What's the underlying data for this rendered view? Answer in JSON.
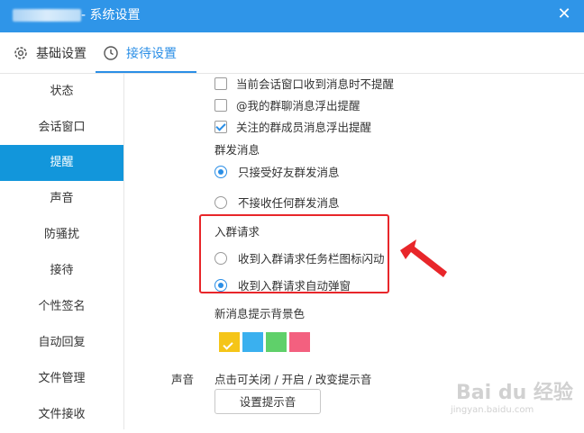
{
  "window": {
    "title": "- 系统设置",
    "close_glyph": "✕"
  },
  "tabs": [
    {
      "label": "基础设置",
      "icon": "gear-icon"
    },
    {
      "label": "接待设置",
      "icon": "clock-icon",
      "active": true
    }
  ],
  "sidebar": {
    "items": [
      {
        "label": "状态"
      },
      {
        "label": "会话窗口"
      },
      {
        "label": "提醒",
        "active": true
      },
      {
        "label": "声音"
      },
      {
        "label": "防骚扰"
      },
      {
        "label": "接待"
      },
      {
        "label": "个性签名"
      },
      {
        "label": "自动回复"
      },
      {
        "label": "文件管理"
      },
      {
        "label": "文件接收"
      }
    ]
  },
  "notify": {
    "checkboxes": [
      {
        "label": "当前会话窗口收到消息时不提醒",
        "checked": false
      },
      {
        "label": "@我的群聊消息浮出提醒",
        "checked": false
      },
      {
        "label": "关注的群成员消息浮出提醒",
        "checked": true
      }
    ],
    "group_msg": {
      "heading": "群发消息",
      "options": [
        {
          "label": "只接受好友群发消息",
          "checked": true
        },
        {
          "label": "不接收任何群发消息",
          "checked": false
        }
      ]
    },
    "join_request": {
      "heading": "入群请求",
      "options": [
        {
          "label": "收到入群请求任务栏图标闪动",
          "checked": false
        },
        {
          "label": "收到入群请求自动弹窗",
          "checked": true
        }
      ]
    },
    "bg_color": {
      "heading": "新消息提示背景色",
      "swatches": [
        {
          "color": "#f5c518",
          "selected": true
        },
        {
          "color": "#3ab0ef",
          "selected": false
        },
        {
          "color": "#5fd06a",
          "selected": false
        },
        {
          "color": "#f3607f",
          "selected": false
        }
      ]
    },
    "sound": {
      "label": "声音",
      "hint": "点击可关闭 / 开启 / 改变提示音",
      "button_label": "设置提示音"
    }
  },
  "annotation": {
    "box_color": "#e8262a"
  },
  "watermark": {
    "main": "Bai du 经验",
    "sub": "jingyan.baidu.com"
  }
}
